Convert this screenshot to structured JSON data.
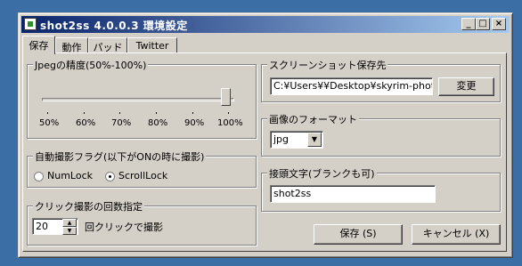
{
  "window": {
    "title": "shot2ss  4.0.0.3 環境設定",
    "minimize_glyph": "_",
    "maximize_glyph": "□",
    "close_glyph": "×"
  },
  "tabs": [
    {
      "label": "保存",
      "active": true
    },
    {
      "label": "動作",
      "active": false
    },
    {
      "label": "パッド",
      "active": false
    },
    {
      "label": "Twitter",
      "active": false
    }
  ],
  "jpeg_quality": {
    "label": "Jpegの精度(50%-100%)",
    "value_percent": 100,
    "ticks": [
      "50%",
      "60%",
      "70%",
      "80%",
      "90%",
      "100%"
    ]
  },
  "auto_capture_flag": {
    "label": "自動撮影フラグ(以下がONの時に撮影)",
    "options": [
      {
        "label": "NumLock",
        "checked": false
      },
      {
        "label": "ScrollLock",
        "checked": true
      }
    ]
  },
  "click_count": {
    "label": "クリック撮影の回数指定",
    "value": "20",
    "suffix": "回クリックで撮影"
  },
  "save_destination": {
    "label": "スクリーンショット保存先",
    "path": "C:¥Users¥¥Desktop¥skyrim-photo",
    "change_button": "変更"
  },
  "image_format": {
    "label": "画像のフォーマット",
    "selected": "jpg"
  },
  "prefix": {
    "label": "接頭文字(ブランクも可)",
    "value": "shot2ss"
  },
  "buttons": {
    "save": "保存 (S)",
    "cancel": "キャンセル (X)"
  }
}
